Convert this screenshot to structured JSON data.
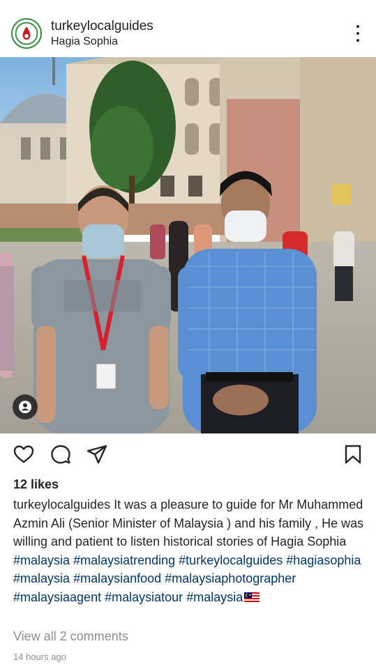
{
  "post": {
    "username": "turkeylocalguides",
    "location": "Hagia Sophia",
    "avatar_icon": "turkey-logo-icon",
    "likes": "12 likes",
    "caption": {
      "username": "turkeylocalguides",
      "text": " It was a pleasure to guide for Mr Muhammed Azmin Ali (Senior Minister of Malaysia ) and his family , He was willing and patient to listen historical stories of Hagia Sophia ",
      "hashtags": [
        "#malaysia",
        "#malaysiatrending",
        "#turkeylocalguides",
        "#hagiasophia",
        "#malaysia",
        "#malaysianfood",
        "#malaysiaphotographer",
        "#malaysiaagent",
        "#malaysiatour",
        "#malaysia"
      ]
    },
    "view_comments": "View all 2 comments",
    "timestamp": "14 hours ago"
  },
  "colors": {
    "text": "#262626",
    "hashtag": "#00376b",
    "muted": "#8e8e8e"
  },
  "icons": [
    "more-vertical-icon",
    "user-tag-icon",
    "heart-icon",
    "comment-icon",
    "share-icon",
    "bookmark-icon",
    "malaysia-flag-icon"
  ]
}
